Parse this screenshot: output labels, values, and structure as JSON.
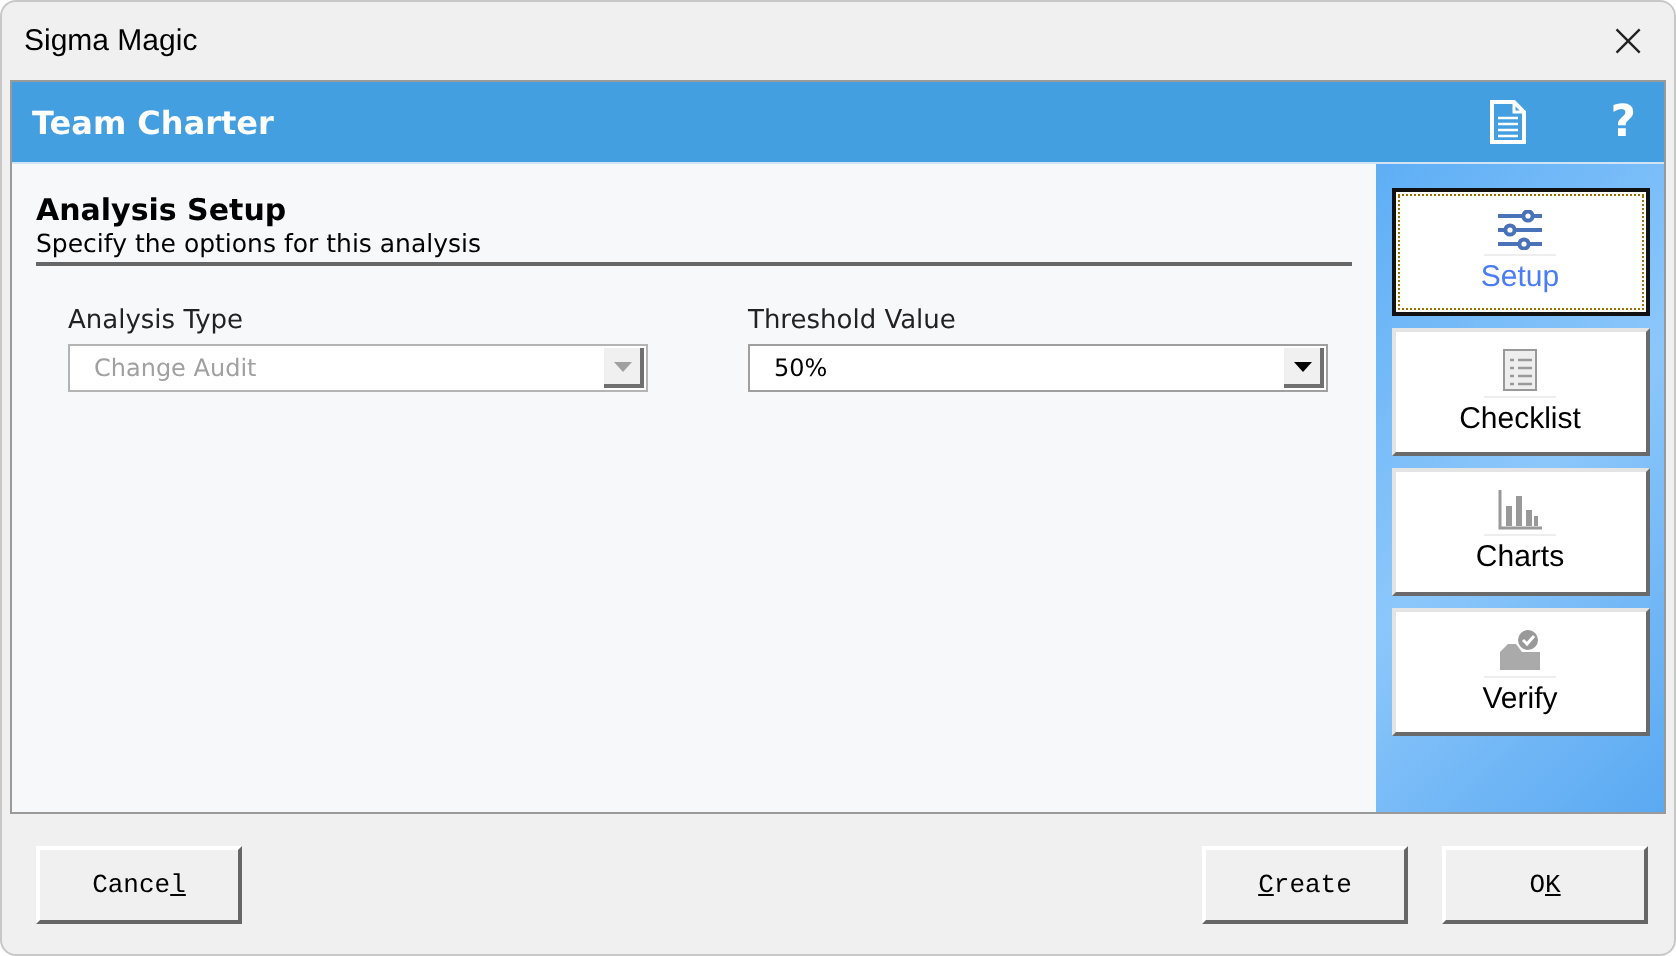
{
  "window": {
    "title": "Sigma Magic",
    "close": "×"
  },
  "header": {
    "title": "Team Charter",
    "help": "?"
  },
  "section": {
    "title": "Analysis Setup",
    "subtitle": "Specify the options for this analysis"
  },
  "fields": [
    {
      "label": "Analysis Type",
      "value": "Change Audit",
      "disabled": true
    },
    {
      "label": "Threshold Value",
      "value": "50%",
      "disabled": false
    }
  ],
  "nav": [
    {
      "label": "Setup",
      "kind": "sliders",
      "selected": true
    },
    {
      "label": "Checklist",
      "kind": "checklist",
      "selected": false
    },
    {
      "label": "Charts",
      "kind": "bars",
      "selected": false
    },
    {
      "label": "Verify",
      "kind": "inbox",
      "selected": false
    }
  ],
  "buttons": [
    {
      "parts": [
        {
          "text": "Cance",
          "underlined": false
        },
        {
          "text": "l",
          "underlined": true
        }
      ]
    },
    {
      "parts": [
        {
          "text": "C",
          "underlined": true
        },
        {
          "text": "reate",
          "underlined": false
        }
      ]
    },
    {
      "parts": [
        {
          "text": "O",
          "underlined": false
        },
        {
          "text": "K",
          "underlined": true
        }
      ]
    }
  ]
}
